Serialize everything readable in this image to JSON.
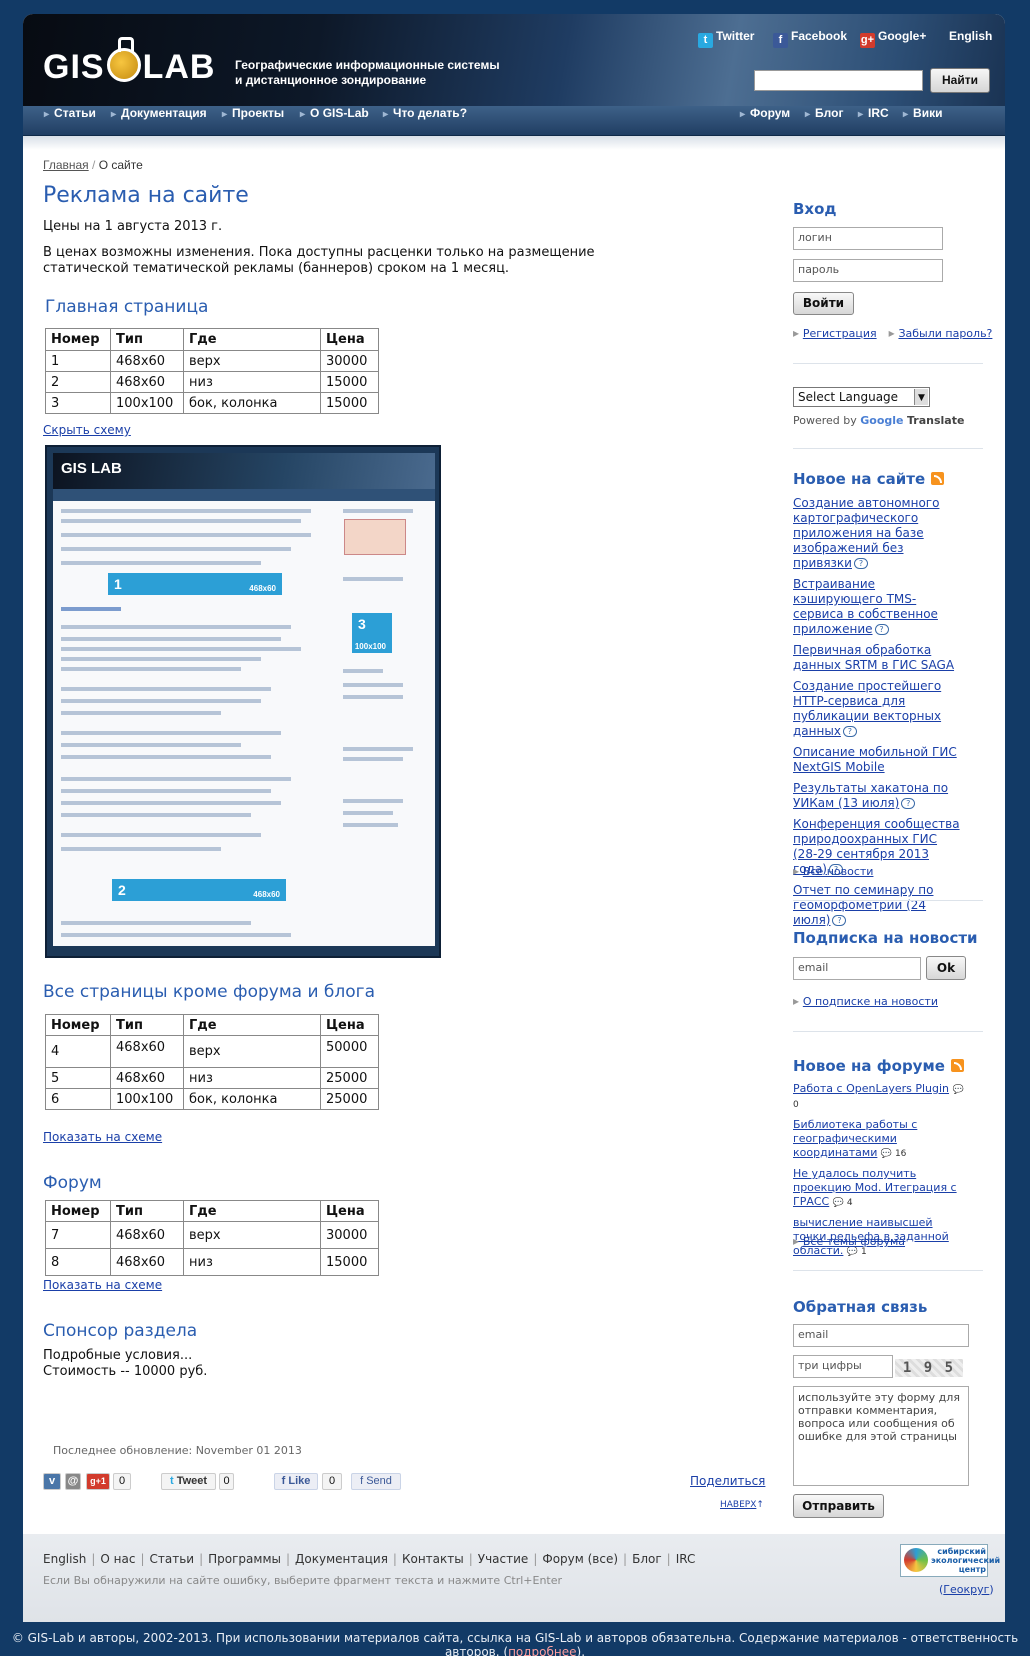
{
  "header": {
    "logo_left": "GIS",
    "logo_right": "LAB",
    "tagline_1": "Географические информационные системы",
    "tagline_2": "и дистанционное зондирование",
    "social": {
      "twitter": "Twitter",
      "facebook": "Facebook",
      "google": "Google+",
      "english": "English"
    },
    "search_button": "Найти"
  },
  "nav": {
    "left": [
      "Статьи",
      "Документация",
      "Проекты",
      "О GIS-Lab",
      "Что делать?"
    ],
    "right": [
      "Форум",
      "Блог",
      "IRC",
      "Вики"
    ]
  },
  "breadcrumb": {
    "home": "Главная",
    "sep": "/",
    "current": "О сайте"
  },
  "main": {
    "title": "Реклама на сайте",
    "prices_date": "Цены на 1 августа 2013 г.",
    "note": "В ценах возможны изменения. Пока доступны расценки только на размещение статической тематической рекламы (баннеров) сроком на 1 месяц.",
    "table_headers": [
      "Номер",
      "Тип",
      "Где",
      "Цена"
    ],
    "section_home": {
      "title": "Главная страница",
      "rows": [
        [
          "1",
          "468x60",
          "верх",
          "30000"
        ],
        [
          "2",
          "468x60",
          "низ",
          "15000"
        ],
        [
          "3",
          "100x100",
          "бок, колонка",
          "15000"
        ]
      ],
      "link": "Скрыть схему"
    },
    "section_all": {
      "title": "Все страницы кроме форума и блога",
      "rows": [
        [
          "4",
          "468x60",
          "верх",
          "50000"
        ],
        [
          "5",
          "468x60",
          "низ",
          "25000"
        ],
        [
          "6",
          "100x100",
          "бок, колонка",
          "25000"
        ]
      ],
      "link": "Показать на схеме"
    },
    "section_forum": {
      "title": "Форум",
      "rows": [
        [
          "7",
          "468x60",
          "верх",
          "30000"
        ],
        [
          "8",
          "468x60",
          "низ",
          "15000"
        ]
      ],
      "link": "Показать на схеме"
    },
    "sponsor": {
      "title": "Спонсор раздела",
      "line1": "Подробные условия...",
      "line2": "Стоимость -- 10000 руб."
    },
    "scheme": {
      "logo": "GIS LAB",
      "banner1_num": "1",
      "banner1_size": "468x60",
      "banner2_num": "2",
      "banner2_size": "468x60",
      "banner3_num": "3",
      "banner3_size": "100x100"
    },
    "last_update": "Последнее обновление: November 01 2013",
    "share": {
      "g_count": "0",
      "tweet": "Tweet",
      "tweet_count": "0",
      "like": "Like",
      "like_count": "0",
      "send": "Send",
      "share_link": "Поделиться",
      "top_link": "НАВЕРХ"
    }
  },
  "sidebar": {
    "login": {
      "title": "Вход",
      "login_placeholder": "логин",
      "password_placeholder": "пароль",
      "submit": "Войти",
      "register": "Регистрация",
      "forgot": "Забыли пароль?"
    },
    "translate": {
      "select": "Select Language",
      "powered": "Powered by",
      "google": "Google",
      "translate": "Translate"
    },
    "news": {
      "title": "Новое на сайте",
      "items": [
        "Создание автономного картографического приложения на базе изображений без привязки",
        "Встраивание кэширующего TMS-сервиса в собственное приложение",
        "Первичная обработка данных SRTM в ГИС SAGA",
        "Создание простейшего HTTP-сервиса для публикации векторных данных",
        "Описание мобильной ГИС NextGIS Mobile",
        "Результаты хакатона по УИКам (13 июля)",
        "Конференция сообщества природоохранных ГИС (28-29 сентября 2013 года)",
        "Отчет по семинару по геоморфометрии (24 июля)"
      ],
      "all": "Все новости"
    },
    "subscribe": {
      "title": "Подписка на новости",
      "placeholder": "email",
      "button": "Ok",
      "about": "О подписке на новости"
    },
    "forum": {
      "title": "Новое на форуме",
      "items": [
        {
          "text": "Работа с OpenLayers Plugin",
          "count": "0"
        },
        {
          "text": "Библиотека работы с географическими координатами",
          "count": "16"
        },
        {
          "text": "Не удалось получить проекцию Mod. Итеграция с ГРАСС",
          "count": "4"
        },
        {
          "text": "вычисление наивысшей точки рельефа в заданной области.",
          "count": "1"
        }
      ],
      "all": "Все темы форума"
    },
    "feedback": {
      "title": "Обратная связь",
      "email": "email",
      "captcha_placeholder": "три цифры",
      "captcha": "1 9 5",
      "message": "используйте эту форму для отправки комментария, вопроса или сообщения об ошибке для этой страницы",
      "submit": "Отправить"
    }
  },
  "footer": {
    "links": [
      "English",
      "О нас",
      "Статьи",
      "Программы",
      "Документация",
      "Контакты",
      "Участие",
      "Форум (все)",
      "Блог",
      "IRC"
    ],
    "note": "Если Вы обнаружили на сайте ошибку, выберите фрагмент текста и нажмите Ctrl+Enter",
    "partner_1": "сибирский",
    "partner_2": "экологический",
    "partner_3": "центр",
    "partner_link": "Геокруг",
    "copyright": "© GIS-Lab и авторы, 2002-2013. При использовании материалов сайта, ссылка на GIS-Lab и авторов обязательна. Содержание материалов - ответственность авторов.",
    "more": "подробнее"
  },
  "colors": {
    "accent": "#2a5db0",
    "link": "#1a3fa8",
    "background": "#123a66",
    "nav": "#203e63",
    "banner": "#2c9fd6"
  }
}
